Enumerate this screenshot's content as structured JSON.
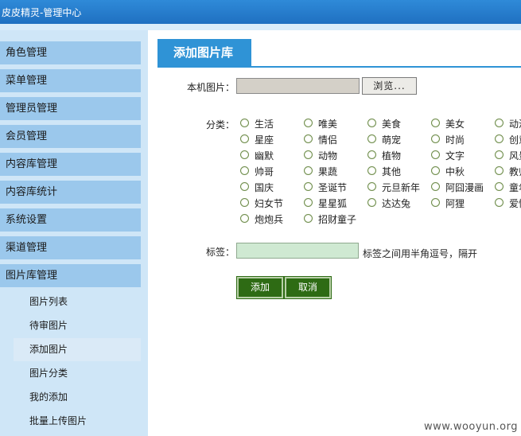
{
  "app_title": "皮皮精灵-管理中心",
  "sidebar": {
    "menu": [
      "角色管理",
      "菜单管理",
      "管理员管理",
      "会员管理",
      "内容库管理",
      "内容库统计",
      "系统设置",
      "渠道管理",
      "图片库管理"
    ],
    "submenu": [
      "图片列表",
      "待审图片",
      "添加图片",
      "图片分类",
      "我的添加",
      "批量上传图片"
    ],
    "active_sub": "添加图片"
  },
  "main": {
    "tab": "添加图片库",
    "local_image_label": "本机图片：",
    "browse_label": "浏览...",
    "category_label": "分类：",
    "categories": [
      "生活",
      "唯美",
      "美食",
      "美女",
      "动漫",
      "星座",
      "情侣",
      "萌宠",
      "时尚",
      "创意",
      "幽默",
      "动物",
      "植物",
      "文字",
      "风景",
      "帅哥",
      "果蔬",
      "其他",
      "中秋",
      "教师",
      "国庆",
      "圣诞节",
      "元旦新年",
      "阿囧漫画",
      "童年",
      "妇女节",
      "星星狐",
      "达达兔",
      "阿狸",
      "爱情",
      "炮炮兵",
      "招财童子"
    ],
    "tag_label": "标签：",
    "tag_value": "",
    "tag_hint": "标签之间用半角逗号，隔开",
    "add_button": "添加",
    "cancel_button": "取消"
  },
  "watermark": "www.wooyun.org"
}
